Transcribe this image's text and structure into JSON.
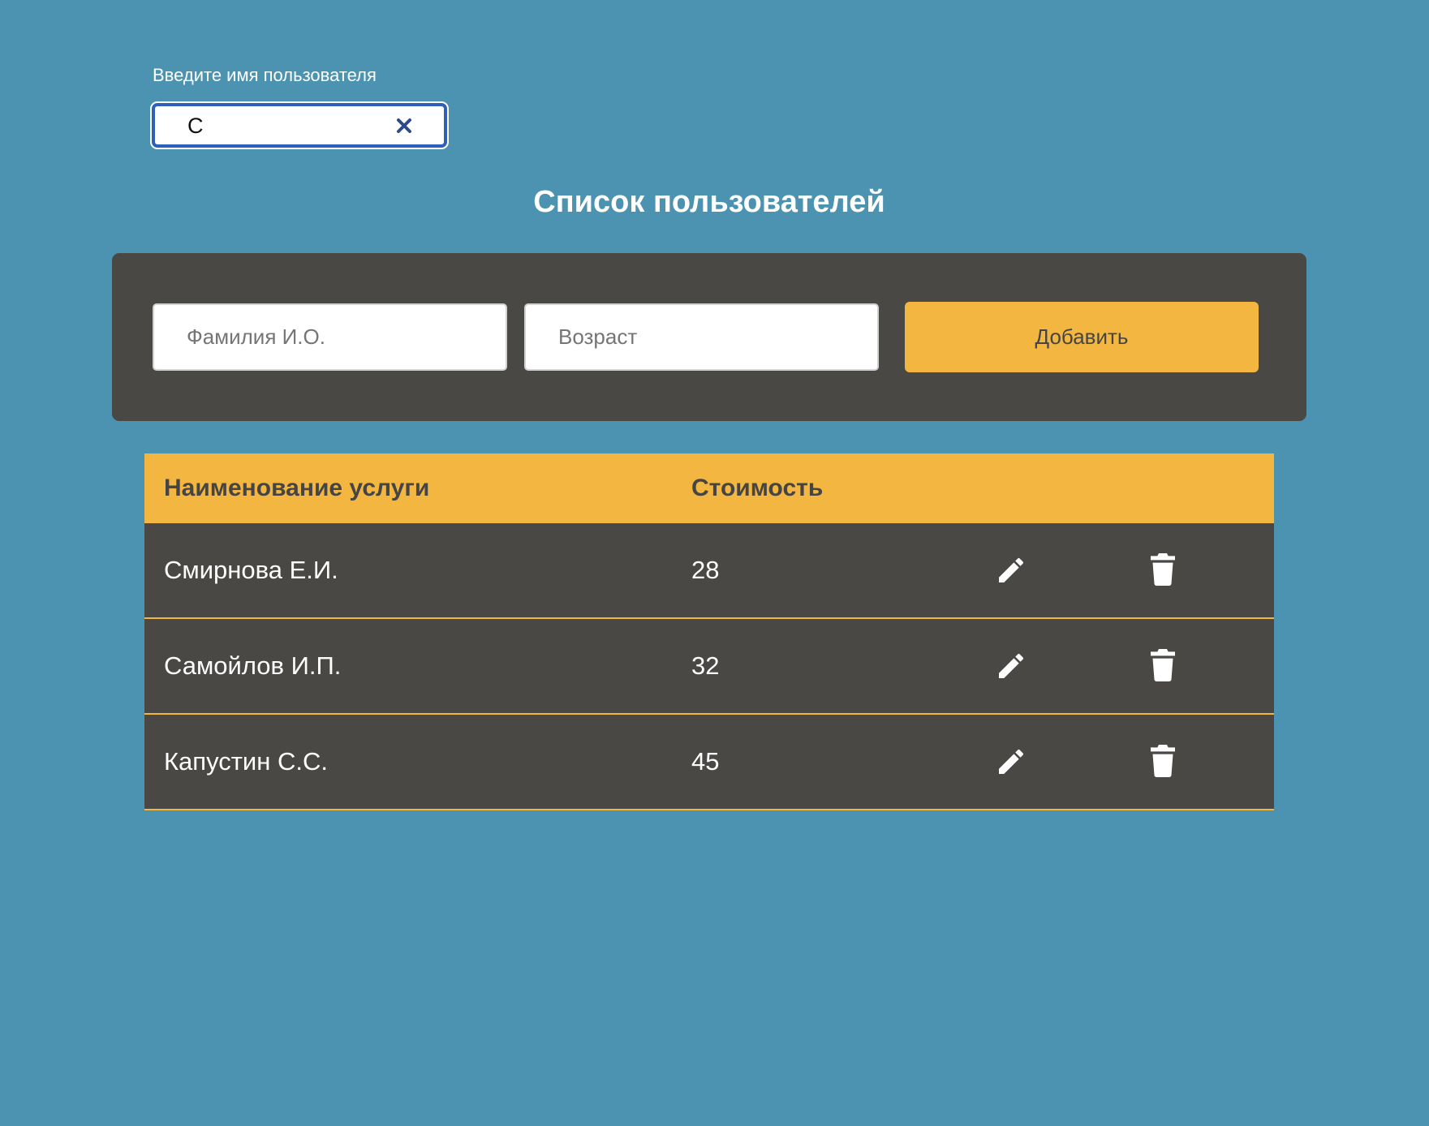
{
  "search": {
    "label": "Введите имя пользователя",
    "value": "С",
    "clear_icon": "close-icon"
  },
  "page": {
    "title": "Список пользователей"
  },
  "form": {
    "name_placeholder": "Фамилия И.О.",
    "age_placeholder": "Возраст",
    "add_label": "Добавить"
  },
  "table": {
    "headers": {
      "name": "Наименование услуги",
      "cost": "Стоимость"
    },
    "rows": [
      {
        "name": "Смирнова Е.И.",
        "cost": "28",
        "edit_icon": "pencil-icon",
        "delete_icon": "trash-icon"
      },
      {
        "name": "Самойлов И.П.",
        "cost": "32",
        "edit_icon": "pencil-icon",
        "delete_icon": "trash-icon"
      },
      {
        "name": "Капустин С.С.",
        "cost": "45",
        "edit_icon": "pencil-icon",
        "delete_icon": "trash-icon"
      }
    ]
  },
  "colors": {
    "background": "#4b93b0",
    "panel": "#494845",
    "accent": "#f3b640",
    "focus_border": "#2f5fb8",
    "text_light": "#ffffff",
    "text_dark": "#454545"
  }
}
